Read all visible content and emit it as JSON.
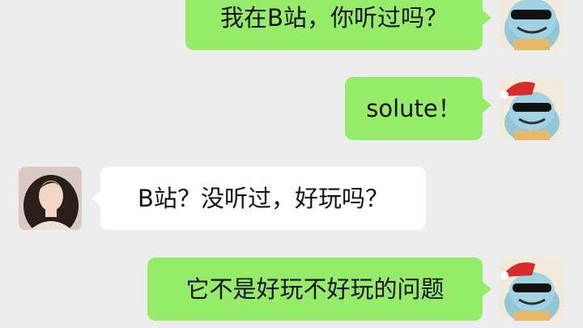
{
  "colors": {
    "background": "#ededed",
    "my_bubble": "#95ec69",
    "their_bubble": "#ffffff",
    "text": "#111111"
  },
  "messages": [
    {
      "sender": "me",
      "avatar": "squirtle-sunglasses-avatar",
      "text": "我在B站，你听过吗？"
    },
    {
      "sender": "me",
      "avatar": "squirtle-sunglasses-avatar",
      "text": "solute！"
    },
    {
      "sender": "other",
      "avatar": "girl-portrait-avatar",
      "text": "B站？没听过，好玩吗？"
    },
    {
      "sender": "me",
      "avatar": "squirtle-sunglasses-avatar",
      "text": "它不是好玩不好玩的问题"
    }
  ]
}
